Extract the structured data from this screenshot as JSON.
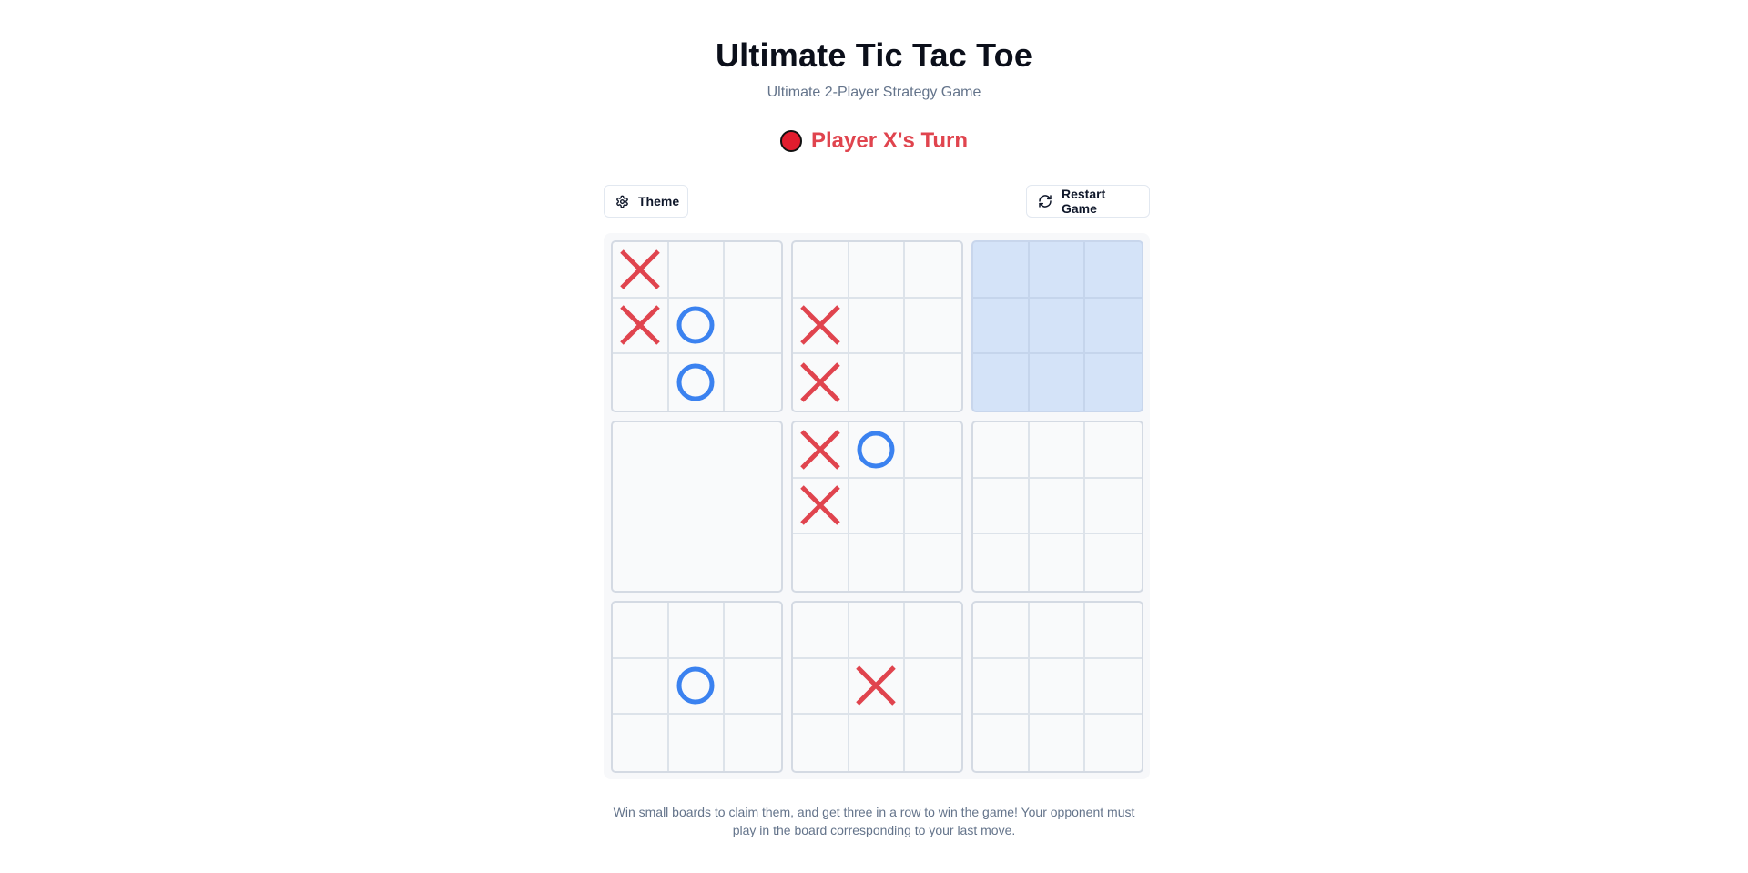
{
  "header": {
    "title": "Ultimate Tic Tac Toe",
    "subtitle": "Ultimate 2-Player Strategy Game"
  },
  "status": {
    "turn_text": "Player X's Turn",
    "turn_color": "#e11d2e"
  },
  "toolbar": {
    "theme_label": "Theme",
    "restart_label": "Restart Game"
  },
  "colors": {
    "x_mark": "#e0444e",
    "o_mark": "#3b82f0",
    "active_board": "#d4e3f8"
  },
  "board": {
    "active_board_index": 2,
    "boards": [
      {
        "status": "in-play",
        "cells": [
          "X",
          "",
          "",
          "X",
          "O",
          "",
          "",
          "O",
          ""
        ]
      },
      {
        "status": "in-play",
        "cells": [
          "",
          "",
          "",
          "X",
          "",
          "",
          "X",
          "",
          ""
        ]
      },
      {
        "status": "in-play",
        "cells": [
          "",
          "",
          "",
          "",
          "",
          "",
          "",
          "",
          ""
        ]
      },
      {
        "status": "claimed",
        "cells": []
      },
      {
        "status": "in-play",
        "cells": [
          "X",
          "O",
          "",
          "X",
          "",
          "",
          "",
          "",
          ""
        ]
      },
      {
        "status": "in-play",
        "cells": [
          "",
          "",
          "",
          "",
          "",
          "",
          "",
          "",
          ""
        ]
      },
      {
        "status": "in-play",
        "cells": [
          "",
          "",
          "",
          "",
          "O",
          "",
          "",
          "",
          ""
        ]
      },
      {
        "status": "in-play",
        "cells": [
          "",
          "",
          "",
          "",
          "X",
          "",
          "",
          "",
          ""
        ]
      },
      {
        "status": "in-play",
        "cells": [
          "",
          "",
          "",
          "",
          "",
          "",
          "",
          "",
          ""
        ]
      }
    ]
  },
  "footer": {
    "line1": "Win small boards to claim them, and get three in a row to win the game! Your opponent must",
    "line2": "play in the board corresponding to your last move."
  }
}
